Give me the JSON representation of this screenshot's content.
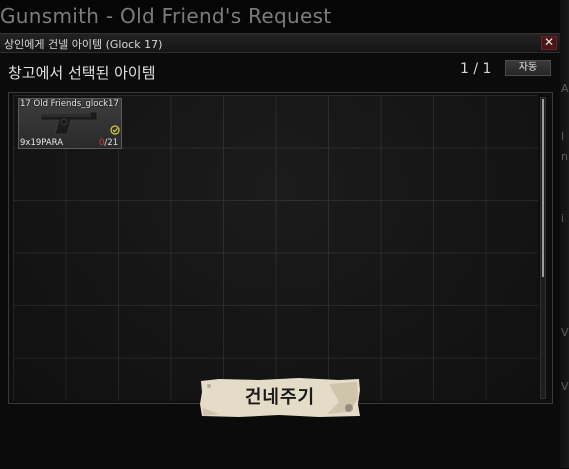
{
  "background": {
    "title": "Gunsmith - Old Friend's Request"
  },
  "dialog": {
    "title": "상인에게 건넬 아이템 (Glock 17)",
    "close_label": "✕",
    "subheader": "창고에서 선택된 아이템",
    "page_counter": "1 / 1",
    "auto_button": "자동",
    "grid": {
      "columns": 10,
      "rows": 6
    },
    "item": {
      "name": "17 Old Friends_glock17",
      "ammo_type": "9x19PARA",
      "ammo_loaded": "0",
      "ammo_capacity": "/21",
      "icon": "pistol-icon",
      "status_icon": "check-icon"
    },
    "deliver_button": "건네주기"
  },
  "colors": {
    "background": "#060606",
    "dialog": "#0b0b0b",
    "button_paper": "#e4dcc6",
    "ammo_zero": "#d43a3a",
    "check": "#d6d13a"
  }
}
